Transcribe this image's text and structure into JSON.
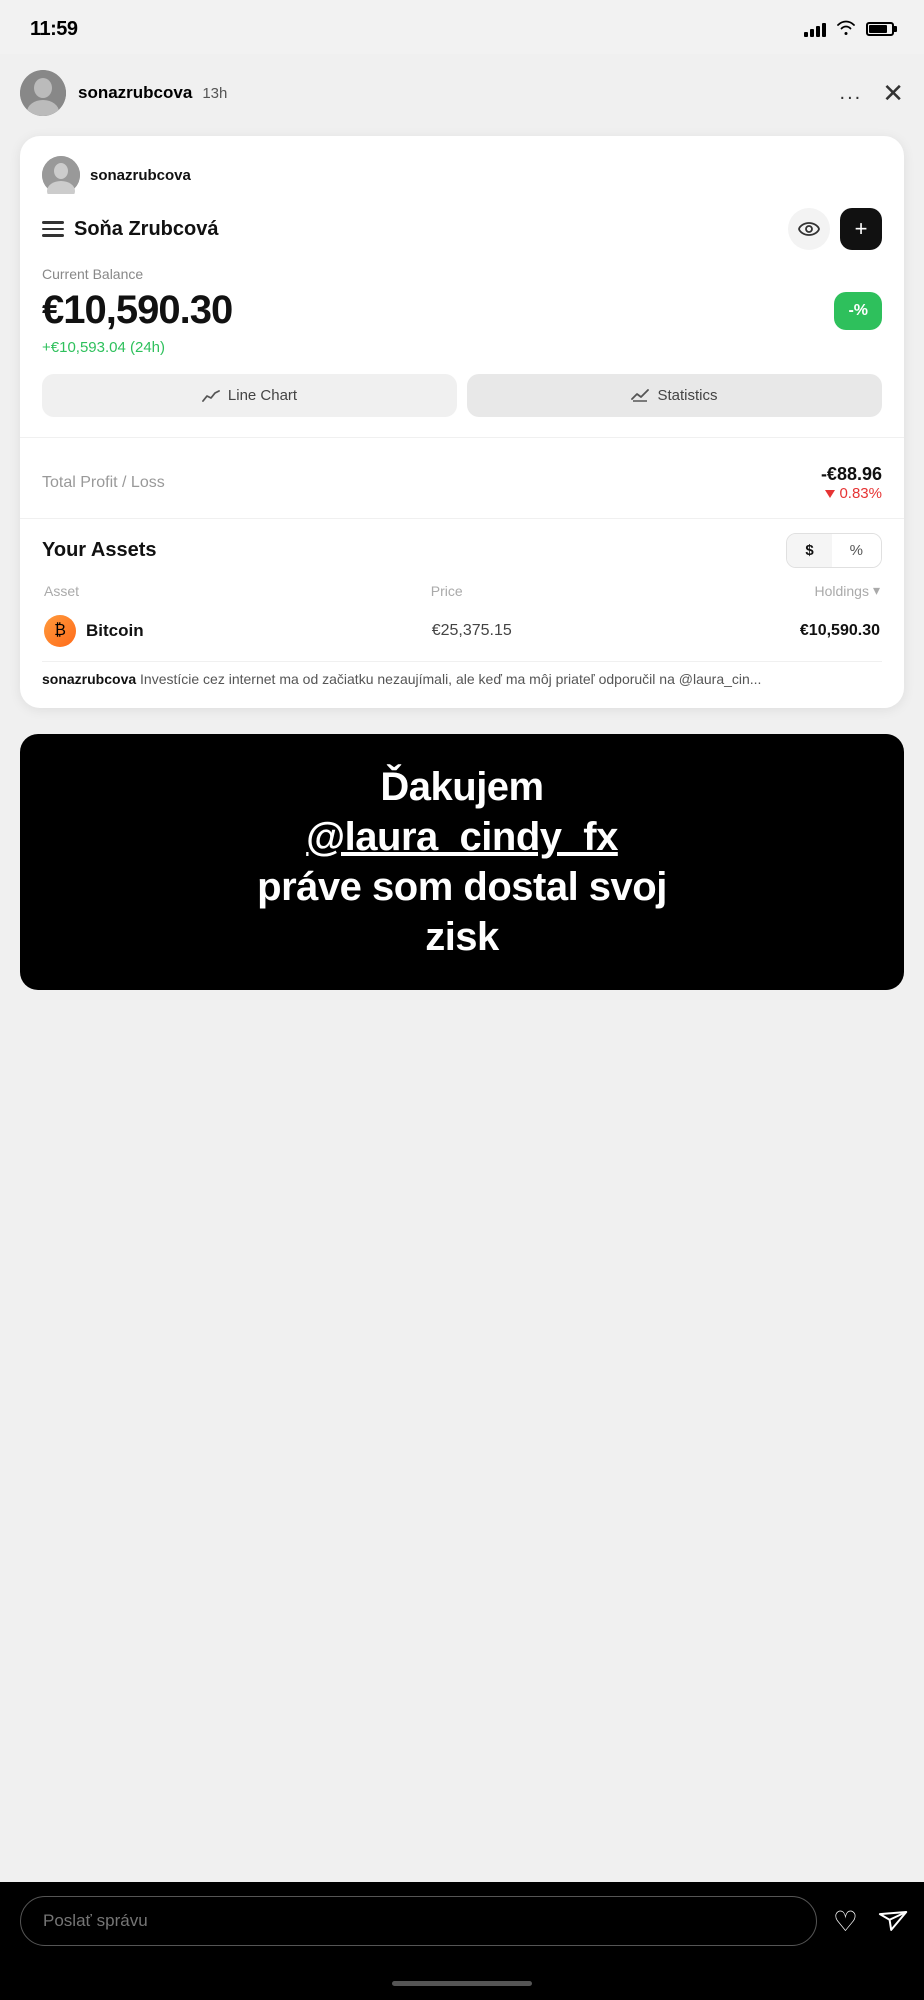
{
  "statusBar": {
    "time": "11:59",
    "battery_pct": 80
  },
  "storyHeader": {
    "username": "sonazrubcova",
    "time_ago": "13h",
    "dots": "...",
    "close": "✕"
  },
  "card": {
    "username": "sonazrubcova",
    "profile_name": "Soňa Zrubcová",
    "balance_label": "Current Balance",
    "balance_amount": "€10,590.30",
    "percent_btn": "-%",
    "balance_change": "+€10,593.04 (24h)",
    "line_chart_btn": "Line Chart",
    "statistics_btn": "Statistics",
    "profit_label": "Total Profit / Loss",
    "profit_amount": "-€88.96",
    "profit_percent": "0.83%",
    "assets_title": "Your Assets",
    "toggle_dollar": "$",
    "toggle_percent": "%",
    "col_asset": "Asset",
    "col_price": "Price",
    "col_holdings": "Holdings",
    "asset_name": "Bitcoin",
    "asset_price": "€25,375.15",
    "asset_holdings": "€10,590.30",
    "caption_user": "sonazrubcova",
    "caption_text": " Investície cez internet ma od začiatku nezaujímali, ale keď ma môj priateľ odporučil na @laura_cin..."
  },
  "textOverlay": {
    "line1": "Ďakujem",
    "line2": "@laura_cindy_fx",
    "line3": "práve som dostal svoj",
    "line4": "zisk"
  },
  "bottomBar": {
    "placeholder": "Poslať správu"
  }
}
